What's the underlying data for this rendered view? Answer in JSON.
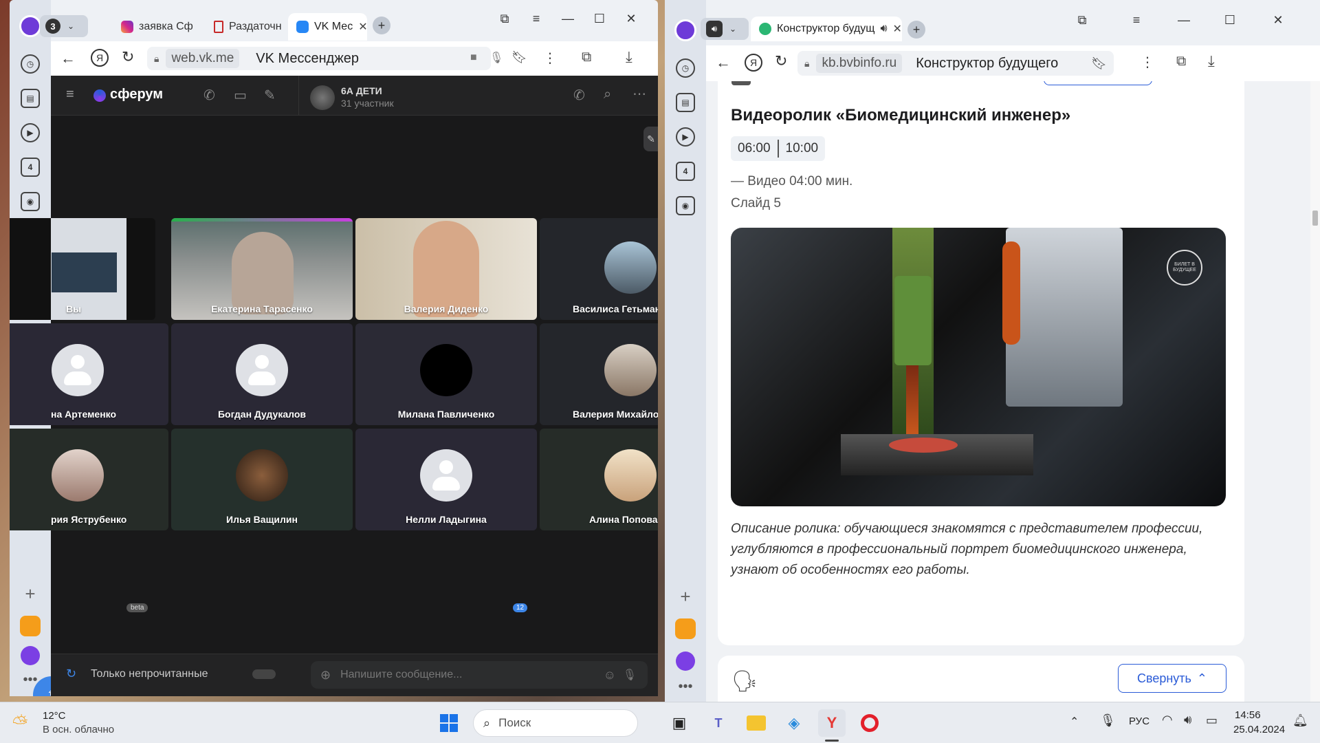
{
  "left_window": {
    "tab_count": "3",
    "tabs": [
      "заявка Сф",
      "Раздаточн",
      "VK Мес"
    ],
    "url_domain": "web.vk.me",
    "page_title": "VK Мессенджер",
    "vk": {
      "logo_text": "сферум",
      "chat_name": "6А ДЕТИ",
      "chat_members": "31 участник",
      "participants": [
        "Вы",
        "Екатерина Тарасенко",
        "Валерия Диденко",
        "Василиса Гетьман",
        "на Артеменко",
        "Богдан Дудукалов",
        "Милана Павличенко",
        "Валерия Михайло",
        "рия Яструбенко",
        "Илья Ващилин",
        "Нелли Ладыгина",
        "Алина Попова"
      ],
      "beta_label": "beta",
      "participants_badge": "12",
      "unread_only_label": "Только непрочитанные",
      "message_placeholder": "Напишите сообщение..."
    }
  },
  "right_window": {
    "tab_title": "Конструктор будущ",
    "url_domain": "kb.bvbinfo.ru",
    "page_title": "Конструктор будущего",
    "content": {
      "heading": "Видеоролик «Биомедицинский инженер»",
      "time_start": "06:00",
      "time_end": "10:00",
      "video_meta": "— Видео 04:00 мин.",
      "slide": "Слайд 5",
      "watermark_text": "БИЛЕТ В БУДУЩЕЕ",
      "description": "Описание ролика: обучающиеся знакомятся с представителем профессии, углубляются в профессиональный портрет биомедицинского инженера, узнают об особенностях его работы.",
      "collapse_button": "Свернуть"
    }
  },
  "taskbar": {
    "weather_temp": "12°C",
    "weather_desc": "В осн. облачно",
    "search_placeholder": "Поиск",
    "language": "РУС",
    "time": "14:56",
    "date": "25.04.2024"
  },
  "colors": {
    "vk_bg": "#19191a",
    "end_call": "#e64646",
    "accent_blue": "#1a73e8",
    "bvb_border": "#2a5bd7"
  }
}
